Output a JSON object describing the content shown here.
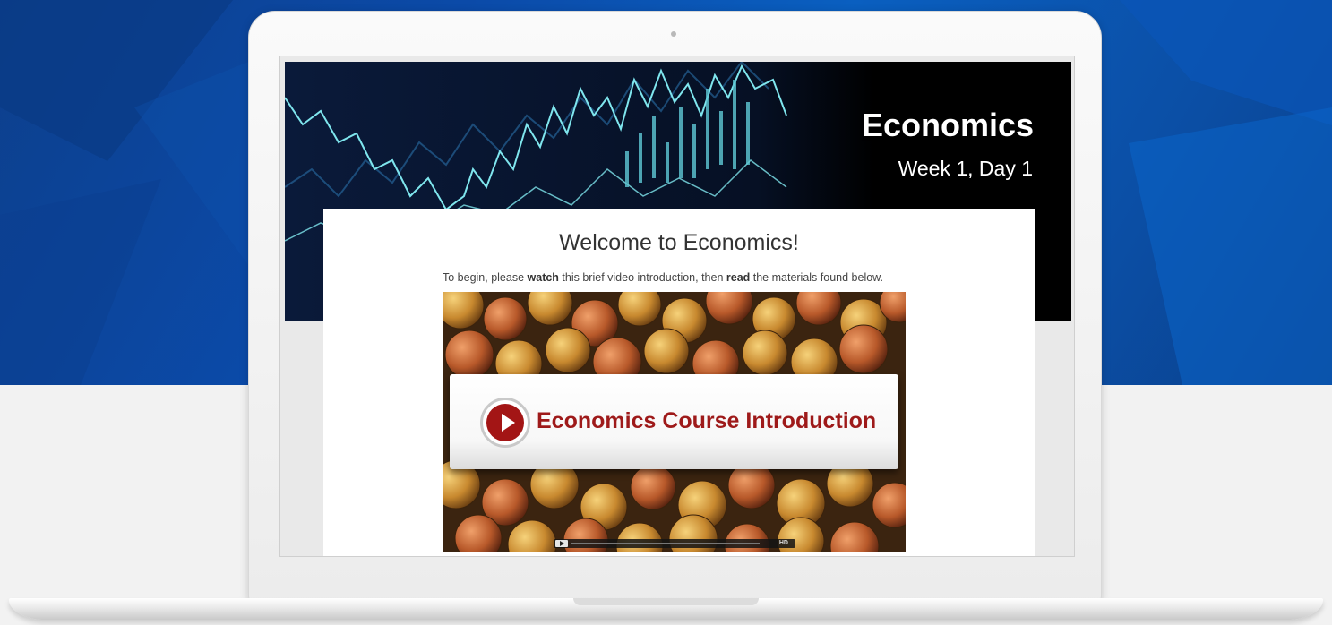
{
  "banner": {
    "course_title": "Economics",
    "course_subtitle": "Week 1, Day 1"
  },
  "content": {
    "heading": "Welcome to Economics!",
    "intro": {
      "part1": "To begin, please ",
      "bold1": "watch",
      "part2": " this brief video introduction, then ",
      "bold2": "read",
      "part3": " the materials found below."
    }
  },
  "video": {
    "title": "Economics Course Introduction",
    "hd_label": "HD",
    "play_icon": "play-icon"
  },
  "colors": {
    "background_blue": "#0b4aa8",
    "brand_red": "#a31515",
    "video_title_red": "#9e1a1a",
    "chart_line": "#7fe6ee"
  }
}
